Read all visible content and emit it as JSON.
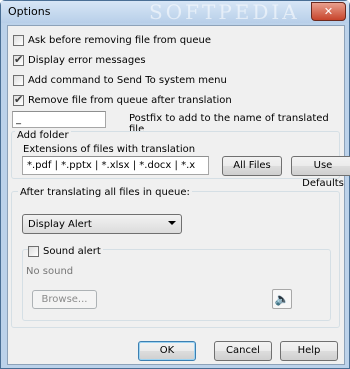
{
  "window": {
    "title": "Options",
    "watermark": "SOFTPEDIA",
    "close_glyph": "✕"
  },
  "options": [
    {
      "label": "Ask before removing file from queue",
      "checked": false
    },
    {
      "label": "Display error messages",
      "checked": true
    },
    {
      "label": "Add command to Send To system menu",
      "checked": false
    },
    {
      "label": "Remove file from queue after translation",
      "checked": true
    }
  ],
  "postfix": {
    "value": "_",
    "label": "Postfix to add to the name of translated file"
  },
  "add_folder": {
    "title": "Add folder",
    "extensions_label": "Extensions of files with translation",
    "extensions_value": "*.pdf | *.pptx | *.xlsx | *.docx | *.x",
    "all_files_button": "All Files",
    "use_defaults_button": "Use Defaults"
  },
  "after": {
    "title": "After translating all files in queue:",
    "selected": "Display Alert",
    "sound_alert_label": "Sound alert",
    "sound_alert_checked": false,
    "sound_file": "No sound",
    "browse_button": "Browse..."
  },
  "footer": {
    "ok": "OK",
    "cancel": "Cancel",
    "help": "Help"
  },
  "icons": {
    "checkbox_check": "check-mark-icon",
    "sound_icon": "speaker-icon"
  }
}
